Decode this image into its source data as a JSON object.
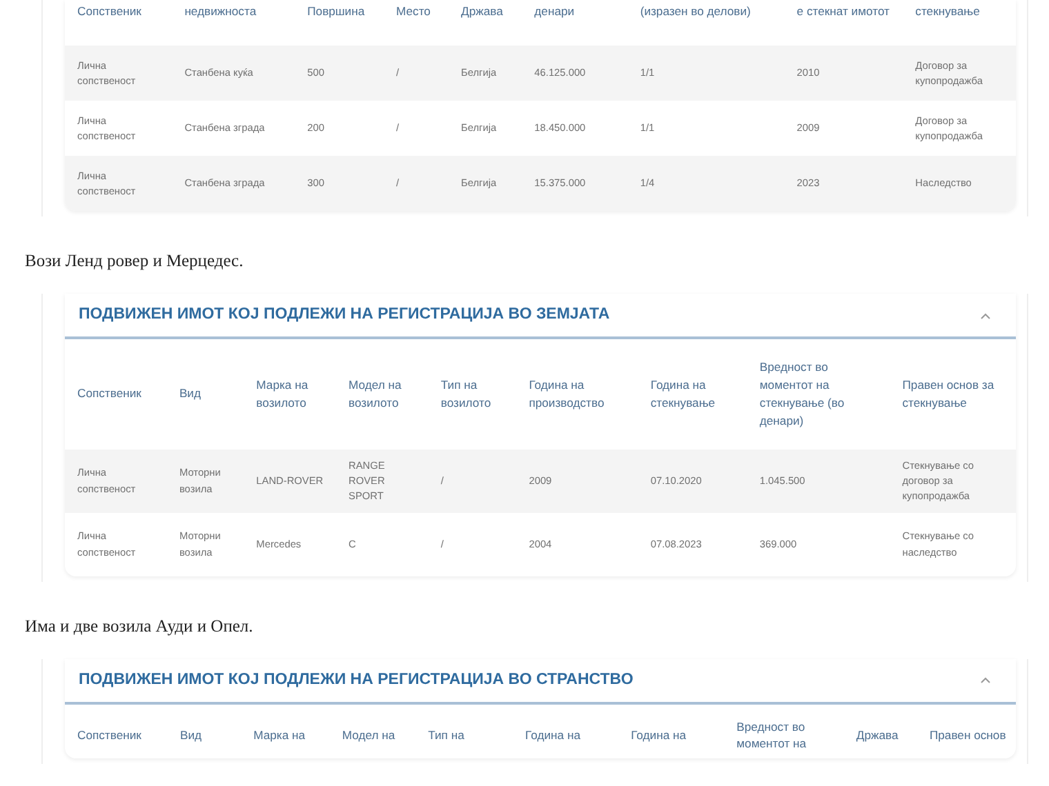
{
  "blocks": [
    {
      "kind": "card",
      "columns": [
        "Сопственик",
        "недвижноста",
        "Површина",
        "Место",
        "Држава",
        "денари",
        "(изразен во делови)",
        "е стекнат имотот",
        "стекнување"
      ],
      "rows": [
        {
          "cells": [
            "Лична сопственост",
            "Станбена куќа",
            "500",
            "/",
            "Белгија",
            "46.125.000",
            "1/1",
            "2010",
            "Договор за купопродажба"
          ]
        },
        {
          "cells": [
            "Лична сопственост",
            "Станбена зграда",
            "200",
            "/",
            "Белгија",
            "18.450.000",
            "1/1",
            "2009",
            "Договор за купопродажба"
          ]
        },
        {
          "cells": [
            "Лична сопственост",
            "Станбена зграда",
            "300",
            "/",
            "Белгија",
            "15.375.000",
            "1/4",
            "2023",
            "Наследство"
          ]
        }
      ]
    },
    {
      "kind": "paragraph",
      "text": "Вози Ленд ровер и Мерцедес."
    },
    {
      "kind": "card",
      "title": "ПОДВИЖЕН ИМОТ КОЈ ПОДЛЕЖИ НА РЕГИСТРАЦИЈА ВО ЗЕМЈАТА",
      "expanded": true,
      "columns": [
        "Сопственик",
        "Вид",
        "Марка на возилото",
        "Модел на возилото",
        "Тип на возилото",
        "Година на производство",
        "Година на стекнување",
        "Вредност во моментот на стекнување (во денари)",
        "Правен основ за стекнување"
      ],
      "rows": [
        {
          "cells": [
            "Лична сопственост",
            "Моторни возила",
            "LAND-ROVER",
            "RANGE ROVER SPORT",
            "/",
            "2009",
            "07.10.2020",
            "1.045.500",
            "Стекнување со договор за купопродажба"
          ]
        },
        {
          "cells": [
            "Лична сопственост",
            "Моторни возила",
            "Mercedes",
            "C",
            "/",
            "2004",
            "07.08.2023",
            "369.000",
            "Стекнување со наследство"
          ]
        }
      ]
    },
    {
      "kind": "paragraph",
      "text": "Има и две возила Ауди и Опел."
    },
    {
      "kind": "card",
      "title": "ПОДВИЖЕН ИМОТ КОЈ ПОДЛЕЖИ НА РЕГИСТРАЦИЈА ВО СТРАНСТВО",
      "expanded": true,
      "columns": [
        "Сопственик",
        "Вид",
        "Марка на",
        "Модел на",
        "Тип на",
        "Година на",
        "Година на",
        "Вредност во моментот на",
        "Држава",
        "Правен основ"
      ]
    }
  ]
}
